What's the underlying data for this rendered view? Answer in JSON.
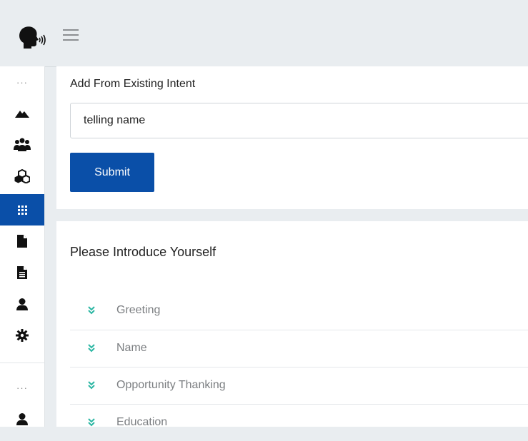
{
  "header": {
    "logo_icon": "speaking-head-icon",
    "menu_icon": "hamburger-icon"
  },
  "sidebar": {
    "items": [
      {
        "icon": "more-dots-icon",
        "glyph": "···",
        "active": false
      },
      {
        "icon": "mountain-icon",
        "active": false
      },
      {
        "icon": "users-icon",
        "active": false
      },
      {
        "icon": "cubes-icon",
        "active": false
      },
      {
        "icon": "grid-icon",
        "active": true
      },
      {
        "icon": "file-icon",
        "active": false
      },
      {
        "icon": "file-text-icon",
        "active": false
      },
      {
        "icon": "user-icon",
        "active": false
      },
      {
        "icon": "gear-icon",
        "active": false
      },
      {
        "icon": "more-dots-icon",
        "glyph": "···",
        "active": false
      },
      {
        "icon": "user-icon",
        "active": false
      }
    ]
  },
  "existing_intent": {
    "label": "Add From Existing Intent",
    "input_value": "telling name",
    "submit_label": "Submit"
  },
  "intent_panel": {
    "title": "Please Introduce Yourself",
    "items": [
      "Greeting",
      "Name",
      "Opportunity Thanking",
      "Education"
    ]
  },
  "colors": {
    "primary": "#0a4fa8",
    "chevron": "#2bb6a3",
    "background": "#e9edf0"
  }
}
